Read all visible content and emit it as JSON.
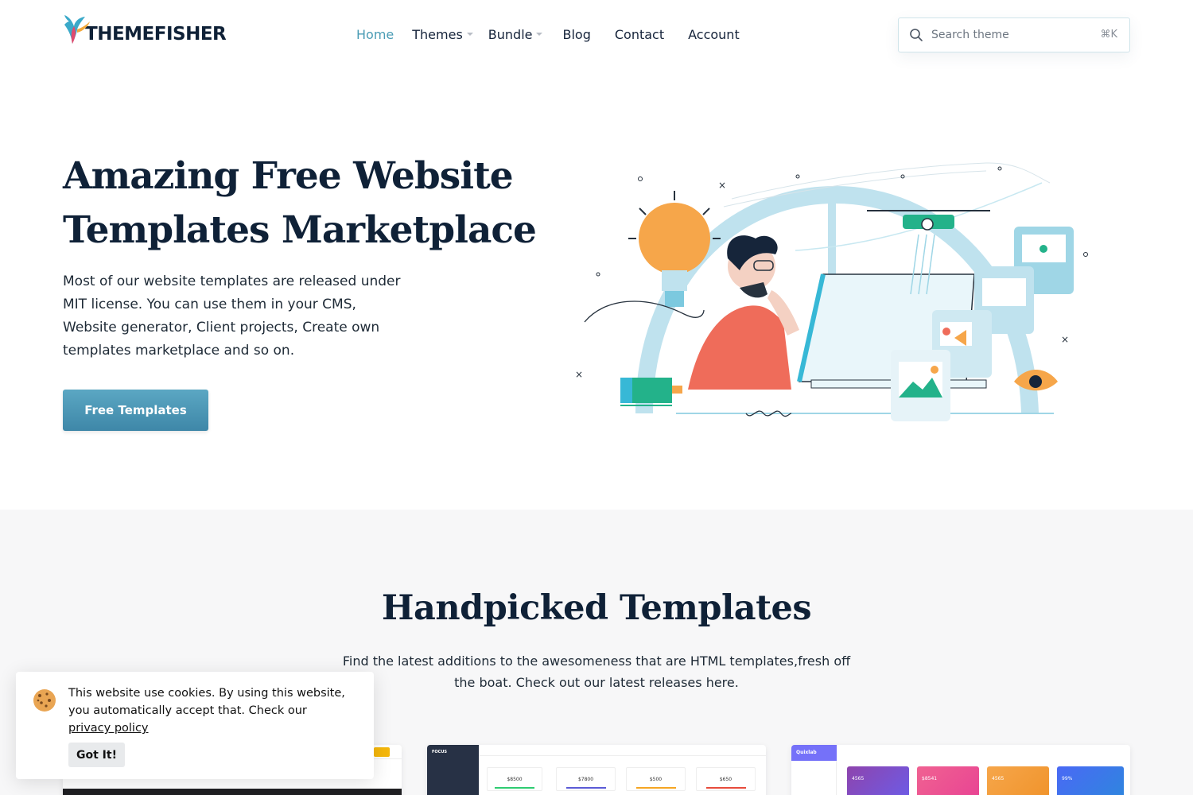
{
  "header": {
    "brand": "THEMEFISHER",
    "nav": [
      {
        "label": "Home",
        "active": true,
        "dropdown": false
      },
      {
        "label": "Themes",
        "active": false,
        "dropdown": true
      },
      {
        "label": "Bundle",
        "active": false,
        "dropdown": true
      },
      {
        "label": "Blog",
        "active": false,
        "dropdown": false
      },
      {
        "label": "Contact",
        "active": false,
        "dropdown": false
      },
      {
        "label": "Account",
        "active": false,
        "dropdown": false
      }
    ],
    "search": {
      "placeholder": "Search theme",
      "shortcut": "⌘K"
    }
  },
  "hero": {
    "title": "Amazing Free Website Templates Marketplace",
    "text": "Most of our website templates are released under MIT license. You can use them in your CMS, Website generator, Client projects, Create own templates marketplace and so on.",
    "cta": "Free Templates"
  },
  "handpicked": {
    "title": "Handpicked Templates",
    "text": "Find the latest additions to the awesomeness that are HTML templates,fresh off the boat. Check out our latest releases here.",
    "cards": [
      {
        "name": "template-card-1"
      },
      {
        "name": "template-card-2",
        "brand": "FOCUS",
        "stats": [
          "$8500",
          "$7800",
          "$500",
          "$650"
        ]
      },
      {
        "name": "template-card-3",
        "brand": "Quixlab",
        "stats": [
          "4565",
          "$8541",
          "4565",
          "99%"
        ]
      }
    ]
  },
  "cookie": {
    "text": "This website use cookies. By using this website, you automatically accept that. Check our",
    "link": "privacy policy",
    "button": "Got It!"
  },
  "colors": {
    "accent": "#4a9cb5",
    "heading": "#0f2137",
    "section_bg": "#f7f7f8"
  }
}
